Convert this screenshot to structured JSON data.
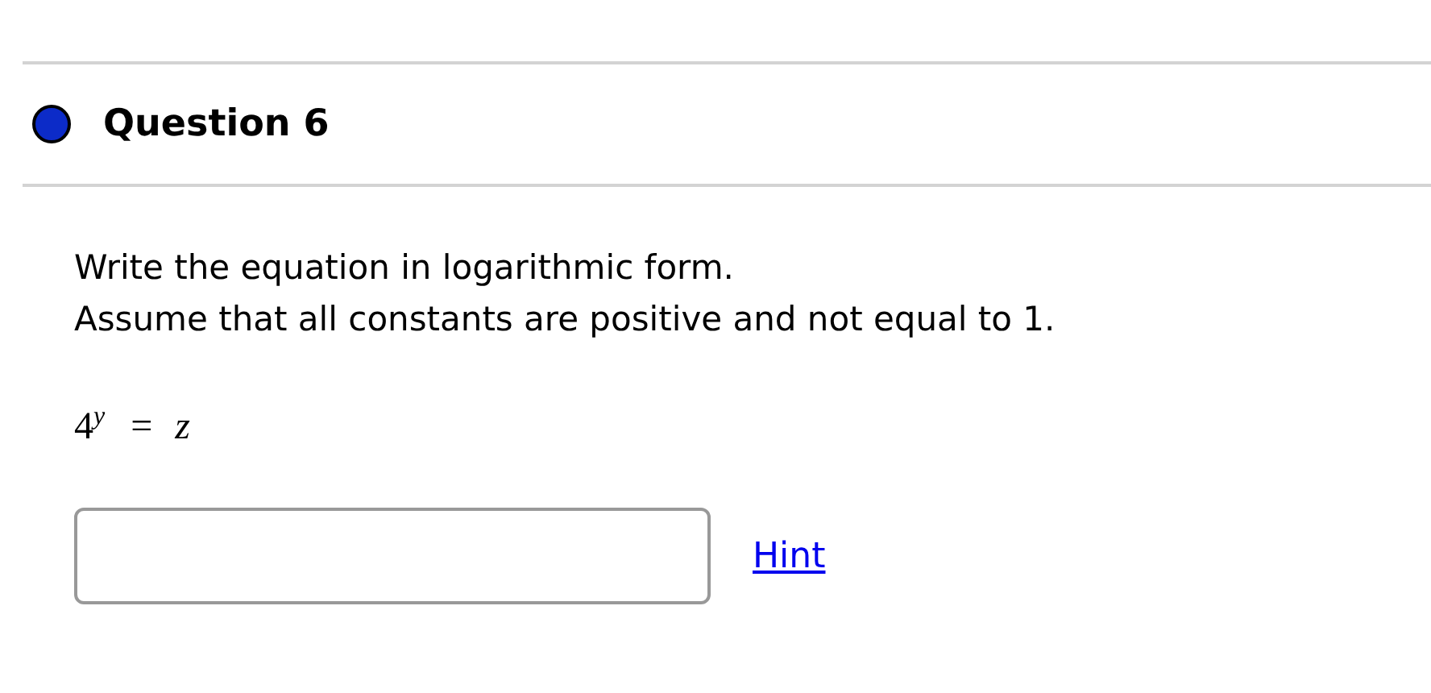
{
  "question": {
    "title": "Question 6"
  },
  "instructions": [
    "Write the equation in logarithmic form.",
    "Assume that all constants are positive and not equal to 1."
  ],
  "equation": {
    "base": "4",
    "exponent": "y",
    "operator": "=",
    "rhs": "z"
  },
  "hint": {
    "label": "Hint"
  }
}
